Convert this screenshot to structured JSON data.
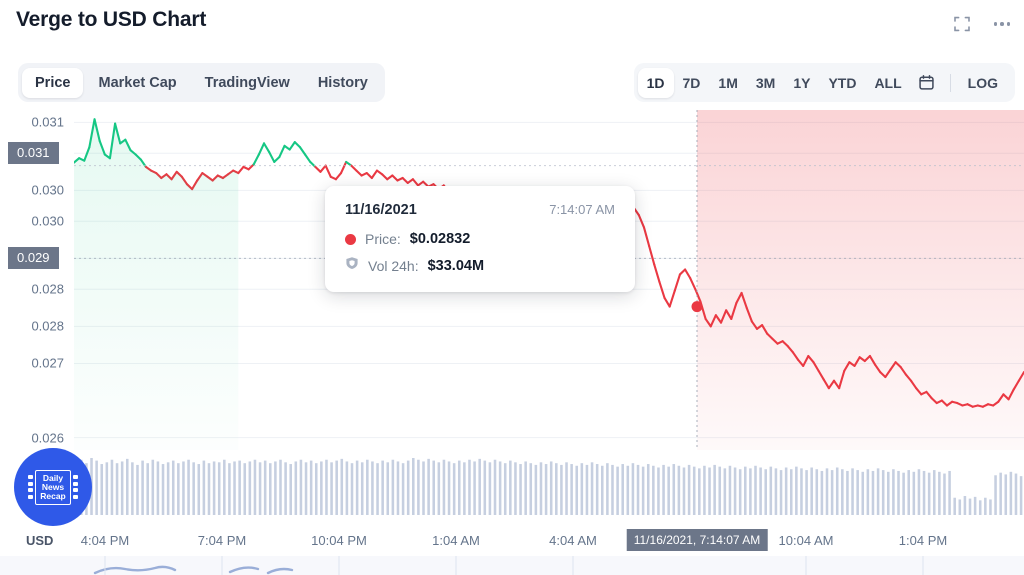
{
  "header": {
    "title": "Verge to USD Chart",
    "fullscreen_icon": "fullscreen-icon",
    "more_icon": "more-options-icon"
  },
  "tabs": [
    {
      "label": "Price",
      "active": true
    },
    {
      "label": "Market Cap",
      "active": false
    },
    {
      "label": "TradingView",
      "active": false
    },
    {
      "label": "History",
      "active": false
    }
  ],
  "ranges": [
    {
      "label": "1D",
      "active": true
    },
    {
      "label": "7D",
      "active": false
    },
    {
      "label": "1M",
      "active": false
    },
    {
      "label": "3M",
      "active": false
    },
    {
      "label": "1Y",
      "active": false
    },
    {
      "label": "YTD",
      "active": false
    },
    {
      "label": "ALL",
      "active": false
    }
  ],
  "range_extras": {
    "calendar_icon": "calendar-icon",
    "log_label": "LOG"
  },
  "tooltip": {
    "date": "11/16/2021",
    "time": "7:14:07 AM",
    "price_label": "Price:",
    "price_value": "$0.02832",
    "volume_label": "Vol 24h:",
    "volume_value": "$33.04M",
    "price_dot_color": "#ea3943",
    "volume_icon": "volume-shield-icon"
  },
  "logo": {
    "line1": "Daily",
    "line2": "News",
    "line3": "Recap",
    "color": "#2f59e8"
  },
  "axis": {
    "currency_label": "USD"
  },
  "colors": {
    "up": "#16c784",
    "down": "#ea3943",
    "badge": "#6c7689",
    "grid": "#eef1f5",
    "volume_bar": "#c6cfe0"
  },
  "chart_data": {
    "type": "line",
    "title": "Verge to USD Chart",
    "xlabel": "",
    "ylabel": "USD",
    "ylim": [
      0.026,
      0.0315
    ],
    "grid": true,
    "legend": false,
    "ytick_labels": [
      "0.031",
      "0.031",
      "0.030",
      "0.030",
      "0.029",
      "0.028",
      "0.028",
      "0.027",
      "0.026"
    ],
    "ytick_values": [
      0.0313,
      0.0308,
      0.0302,
      0.0297,
      0.0291,
      0.0286,
      0.028,
      0.0274,
      0.0262
    ],
    "highlighted_ylabels": [
      "0.031",
      "0.029"
    ],
    "xtick_labels": [
      "4:04 PM",
      "7:04 PM",
      "10:04 PM",
      "1:04 AM",
      "4:04 AM",
      "10:04 AM",
      "1:04 PM"
    ],
    "xtick_positions": [
      105,
      222,
      339,
      456,
      573,
      806,
      923
    ],
    "highlighted_xlabel": "11/16/2021, 7:14:07 AM",
    "highlighted_xlabel_position": 697,
    "crosshair": {
      "x": 697,
      "y": 365,
      "price": 0.02832,
      "time": "7:14:07 AM",
      "date": "11/16/2021"
    },
    "reference_line_value": 0.0306,
    "series": [
      {
        "name": "Price",
        "unit": "USD",
        "segments_up_color": "#16c784",
        "segments_down_color": "#ea3943",
        "values": [
          0.03065,
          0.03072,
          0.03068,
          0.0309,
          0.03135,
          0.031,
          0.03078,
          0.03072,
          0.03128,
          0.03096,
          0.03102,
          0.03085,
          0.03078,
          0.0307,
          0.03058,
          0.03052,
          0.03048,
          0.0304,
          0.03046,
          0.03038,
          0.0305,
          0.03042,
          0.0303,
          0.03022,
          0.03036,
          0.03048,
          0.03042,
          0.03036,
          0.03044,
          0.0304,
          0.03046,
          0.03052,
          0.03048,
          0.03058,
          0.03054,
          0.03062,
          0.03078,
          0.03096,
          0.03082,
          0.03066,
          0.03074,
          0.03092,
          0.03086,
          0.03098,
          0.0309,
          0.03078,
          0.03066,
          0.03058,
          0.0305,
          0.0306,
          0.03042,
          0.03038,
          0.03048,
          0.03066,
          0.0306,
          0.03052,
          0.03044,
          0.03048,
          0.0304,
          0.03052,
          0.03046,
          0.03038,
          0.03044,
          0.03036,
          0.0304,
          0.03032,
          0.03038,
          0.03028,
          0.03034,
          0.03026,
          0.0303,
          0.03022,
          0.03028,
          0.03018,
          0.03024,
          0.03014,
          0.0302,
          0.03012,
          0.03016,
          0.03008,
          0.03012,
          0.03004,
          0.03008,
          0.03,
          0.03004,
          0.02996,
          0.03,
          0.02992,
          0.02988,
          0.02996,
          0.0299,
          0.02982,
          0.02988,
          0.02978,
          0.02984,
          0.02974,
          0.0298,
          0.02986,
          0.02992,
          0.02984,
          0.02996,
          0.03002,
          0.02994,
          0.03006,
          0.03012,
          0.03004,
          0.03014,
          0.03008,
          0.03,
          0.02992,
          0.0298,
          0.0296,
          0.0293,
          0.029,
          0.02872,
          0.02846,
          0.02832,
          0.02858,
          0.02884,
          0.02892,
          0.02878,
          0.0286,
          0.0284,
          0.02812,
          0.028,
          0.02818,
          0.02806,
          0.02826,
          0.02812,
          0.02838,
          0.02854,
          0.0283,
          0.02808,
          0.02796,
          0.02802,
          0.02788,
          0.0278,
          0.02772,
          0.02776,
          0.02768,
          0.02758,
          0.02746,
          0.02736,
          0.02752,
          0.02742,
          0.02728,
          0.02714,
          0.027,
          0.02712,
          0.027,
          0.02728,
          0.02742,
          0.02736,
          0.0275,
          0.02744,
          0.02752,
          0.02738,
          0.02726,
          0.02718,
          0.0273,
          0.02742,
          0.02734,
          0.02722,
          0.02712,
          0.027,
          0.0269,
          0.02694,
          0.02684,
          0.02676,
          0.0268,
          0.02672,
          0.02678,
          0.02676,
          0.02672,
          0.02674,
          0.0267,
          0.02672,
          0.0267,
          0.02674,
          0.02672,
          0.02678,
          0.0269,
          0.02682,
          0.02698,
          0.02712,
          0.02726
        ]
      }
    ],
    "volume_series": {
      "name": "Volume",
      "color": "#c6cfe0",
      "values": [
        62,
        64,
        60,
        66,
        63,
        59,
        61,
        64,
        60,
        62,
        65,
        61,
        58,
        63,
        60,
        64,
        62,
        59,
        61,
        63,
        60,
        62,
        64,
        61,
        59,
        63,
        60,
        62,
        61,
        64,
        60,
        62,
        63,
        60,
        62,
        64,
        61,
        63,
        60,
        62,
        64,
        61,
        59,
        62,
        64,
        61,
        63,
        60,
        62,
        64,
        61,
        63,
        65,
        62,
        60,
        63,
        61,
        64,
        62,
        60,
        63,
        61,
        64,
        62,
        60,
        63,
        66,
        64,
        62,
        65,
        63,
        61,
        64,
        62,
        60,
        63,
        61,
        64,
        62,
        65,
        63,
        61,
        64,
        62,
        60,
        63,
        61,
        59,
        62,
        60,
        58,
        61,
        59,
        62,
        60,
        58,
        61,
        59,
        57,
        60,
        58,
        61,
        59,
        57,
        60,
        58,
        56,
        59,
        57,
        60,
        58,
        56,
        59,
        57,
        55,
        58,
        56,
        59,
        57,
        55,
        58,
        56,
        54,
        57,
        55,
        58,
        56,
        54,
        57,
        55,
        53,
        56,
        54,
        57,
        55,
        53,
        56,
        54,
        52,
        55,
        53,
        56,
        54,
        52,
        55,
        53,
        51,
        54,
        52,
        55,
        53,
        51,
        54,
        52,
        50,
        53,
        51,
        54,
        52,
        50,
        53,
        51,
        49,
        52,
        50,
        53,
        51,
        49,
        52,
        50,
        48,
        51,
        20,
        18,
        22,
        19,
        21,
        17,
        20,
        18,
        46,
        49,
        47,
        50,
        48,
        45
      ]
    }
  }
}
